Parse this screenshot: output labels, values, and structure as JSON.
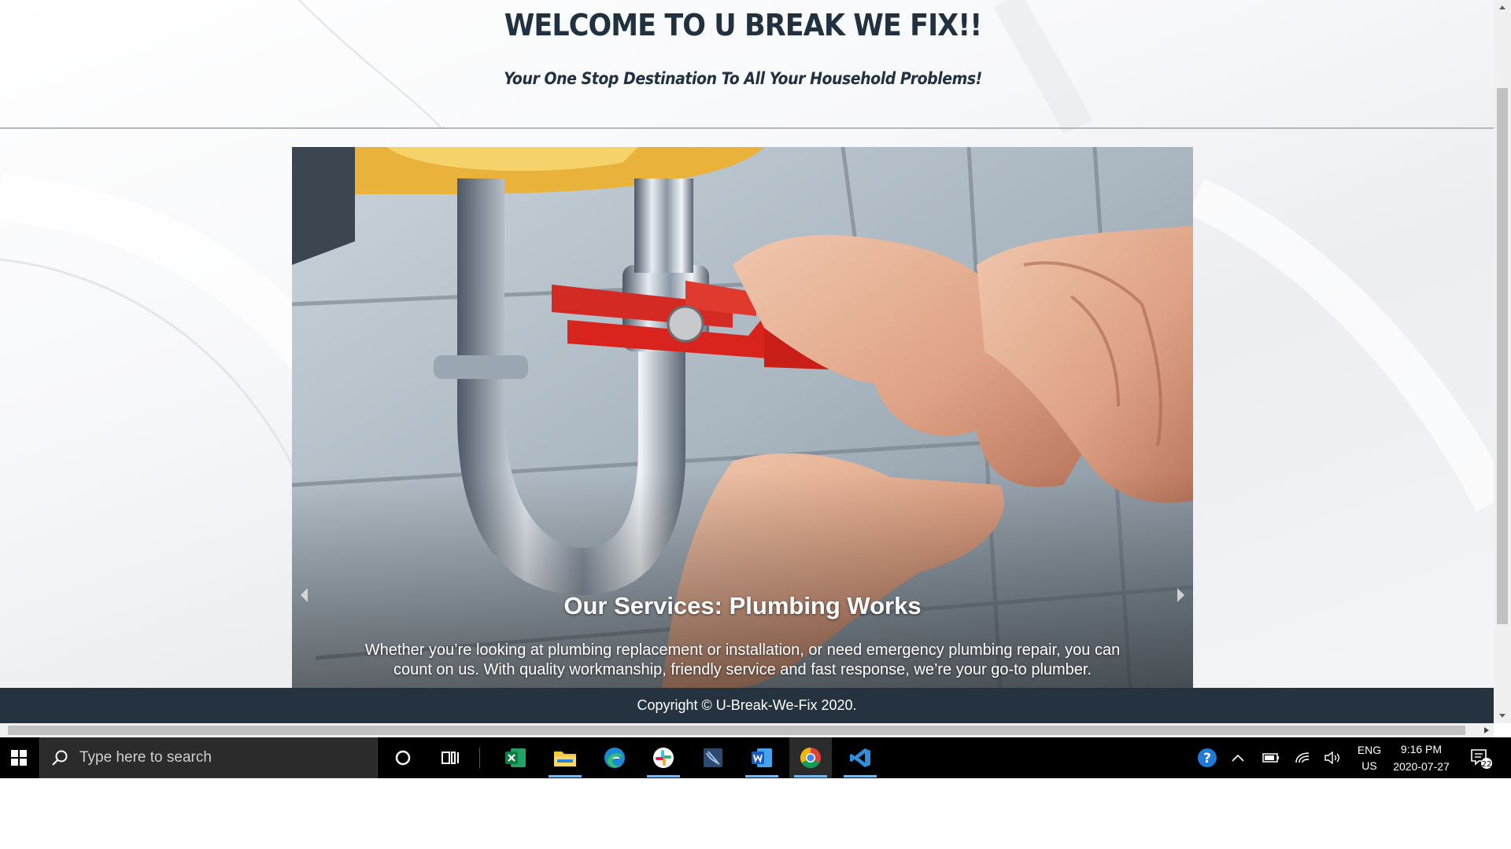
{
  "header": {
    "title": "WELCOME TO U BREAK WE FIX!!",
    "subtitle": "Your One Stop Destination To All Your Household Problems!"
  },
  "carousel": {
    "caption_title": "Our Services: Plumbing Works",
    "caption_text": "Whether you’re looking at plumbing replacement or installation, or need emergency plumbing repair, you can count on us. With quality workmanship, friendly service and fast response, we’re your go-to plumber.",
    "image": "plumber-wrench-under-sink"
  },
  "footer": {
    "copyright": "Copyright © U-Break-We-Fix 2020."
  },
  "taskbar": {
    "search_placeholder": "Type here to search",
    "pinned_apps": [
      "cortana-icon",
      "task-view-icon",
      "excel-icon",
      "file-explorer-icon",
      "edge-icon",
      "slack-icon",
      "dev-tool-icon",
      "word-icon",
      "chrome-icon",
      "vscode-icon"
    ],
    "language": "ENG",
    "region": "US",
    "time": "9:16 PM",
    "date": "2020-07-27",
    "notification_count": "22"
  },
  "colors": {
    "heading": "#22313f",
    "footer_bg": "#253340",
    "taskbar_bg": "#000000",
    "active_indicator": "#76b9ed"
  }
}
